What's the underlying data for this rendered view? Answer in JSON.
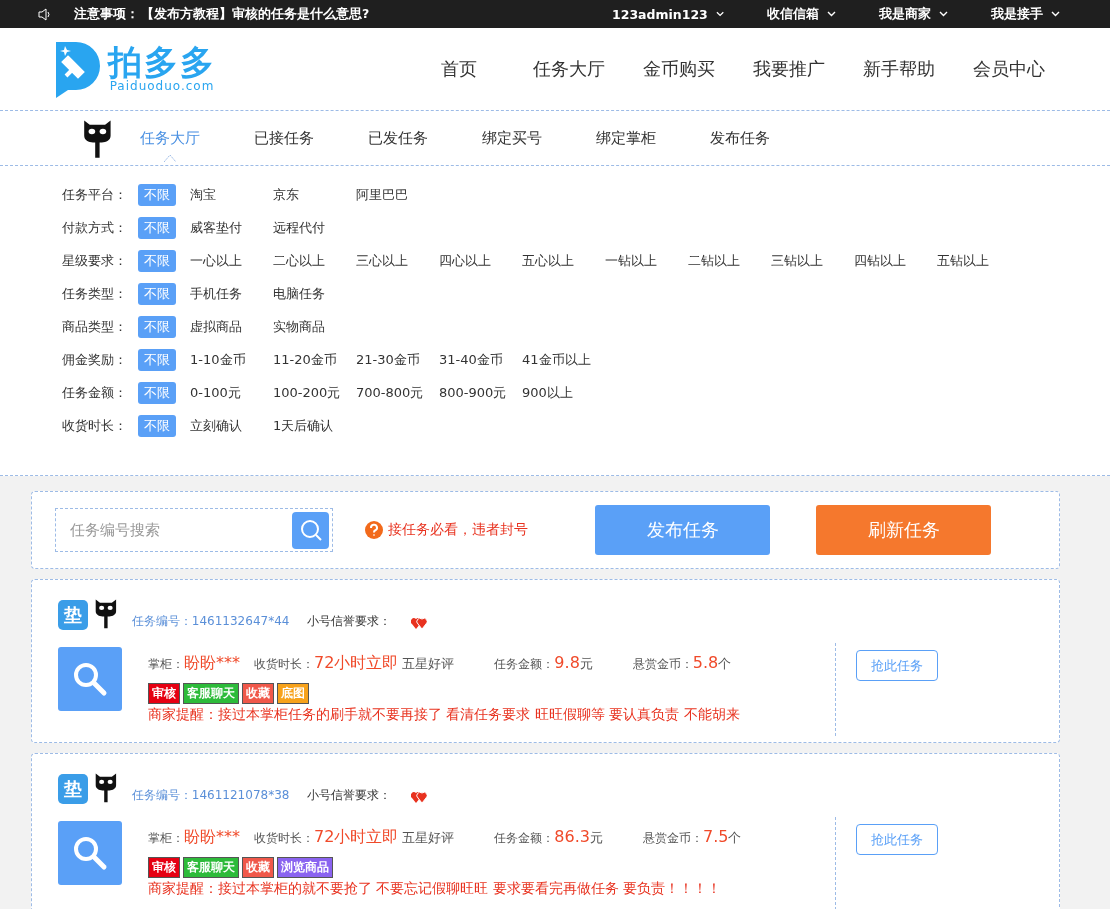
{
  "top_bar": {
    "notice_label": "注意事项：",
    "notice_text": "【发布方教程】审核的任务是什么意思?",
    "menus": [
      "123admin123",
      "收信信箱",
      "我是商家",
      "我是接手"
    ]
  },
  "header": {
    "logo_text": "拍多多",
    "logo_domain": "Paiduoduo.com",
    "nav": [
      {
        "label": "首页",
        "selected": false
      },
      {
        "label": "任务大厅",
        "selected": false
      },
      {
        "label": "金币购买",
        "selected": false
      },
      {
        "label": "我要推广",
        "selected": false
      },
      {
        "label": "新手帮助",
        "selected": false
      },
      {
        "label": "会员中心",
        "selected": false
      }
    ]
  },
  "sub_nav": [
    {
      "label": "任务大厅",
      "selected": true
    },
    {
      "label": "已接任务",
      "selected": false
    },
    {
      "label": "已发任务",
      "selected": false
    },
    {
      "label": "绑定买号",
      "selected": false
    },
    {
      "label": "绑定掌柜",
      "selected": false
    },
    {
      "label": "发布任务",
      "selected": false
    }
  ],
  "filters": [
    {
      "label": "任务平台：",
      "options": [
        {
          "label": "不限",
          "selected": true
        },
        {
          "label": "淘宝",
          "selected": false
        },
        {
          "label": "京东",
          "selected": false
        },
        {
          "label": "阿里巴巴",
          "selected": false
        }
      ]
    },
    {
      "label": "付款方式：",
      "options": [
        {
          "label": "不限",
          "selected": true
        },
        {
          "label": "威客垫付",
          "selected": false
        },
        {
          "label": "远程代付",
          "selected": false
        }
      ]
    },
    {
      "label": "星级要求：",
      "options": [
        {
          "label": "不限",
          "selected": true
        },
        {
          "label": "一心以上",
          "selected": false
        },
        {
          "label": "二心以上",
          "selected": false
        },
        {
          "label": "三心以上",
          "selected": false
        },
        {
          "label": "四心以上",
          "selected": false
        },
        {
          "label": "五心以上",
          "selected": false
        },
        {
          "label": "一钻以上",
          "selected": false
        },
        {
          "label": "二钻以上",
          "selected": false
        },
        {
          "label": "三钻以上",
          "selected": false
        },
        {
          "label": "四钻以上",
          "selected": false
        },
        {
          "label": "五钻以上",
          "selected": false
        }
      ]
    },
    {
      "label": "任务类型：",
      "options": [
        {
          "label": "不限",
          "selected": true
        },
        {
          "label": "手机任务",
          "selected": false
        },
        {
          "label": "电脑任务",
          "selected": false
        }
      ]
    },
    {
      "label": "商品类型：",
      "options": [
        {
          "label": "不限",
          "selected": true
        },
        {
          "label": "虚拟商品",
          "selected": false
        },
        {
          "label": "实物商品",
          "selected": false
        }
      ]
    },
    {
      "label": "佣金奖励：",
      "options": [
        {
          "label": "不限",
          "selected": true
        },
        {
          "label": "1-10金币",
          "selected": false
        },
        {
          "label": "11-20金币",
          "selected": false
        },
        {
          "label": "21-30金币",
          "selected": false
        },
        {
          "label": "31-40金币",
          "selected": false
        },
        {
          "label": "41金币以上",
          "selected": false
        }
      ]
    },
    {
      "label": "任务金额：",
      "options": [
        {
          "label": "不限",
          "selected": true
        },
        {
          "label": "0-100元",
          "selected": false
        },
        {
          "label": "100-200元",
          "selected": false
        },
        {
          "label": "700-800元",
          "selected": false
        },
        {
          "label": "800-900元",
          "selected": false
        },
        {
          "label": "900以上",
          "selected": false
        }
      ]
    },
    {
      "label": "收货时长：",
      "options": [
        {
          "label": "不限",
          "selected": true
        },
        {
          "label": "立刻确认",
          "selected": false
        },
        {
          "label": "1天后确认",
          "selected": false
        }
      ]
    }
  ],
  "toolbar": {
    "search": {
      "placeholder": "任务编号搜索"
    },
    "warning": "接任务必看，违者封号",
    "buttons": [
      {
        "label": "发布任务",
        "kind": "primary"
      },
      {
        "label": "刷新任务",
        "kind": "accent"
      }
    ]
  },
  "tasks": [
    {
      "badge": "垫",
      "id_label": "任务编号：",
      "id": "1461132647*44",
      "credit_label": "小号信誉要求：",
      "shop_label": "掌柜：",
      "shop": "盼盼***",
      "receive_label": "收货时长：",
      "receive": "72小时立即",
      "review": "五星好评",
      "amount_label": "任务金额：",
      "amount": "9.8",
      "amount_unit": "元",
      "reward_label": "悬赏金币：",
      "reward": "5.8",
      "reward_unit": "个",
      "tags": [
        {
          "label": "审核",
          "color": "#e60012"
        },
        {
          "label": "客服聊天",
          "color": "#2dbb3a"
        },
        {
          "label": "收藏",
          "color": "#f0584a"
        },
        {
          "label": "底图",
          "color": "#f7a21b"
        }
      ],
      "reminder": "商家提醒：接过本掌柜任务的刷手就不要再接了 看清任务要求 旺旺假聊等 要认真负责 不能胡来",
      "action": "抢此任务"
    },
    {
      "badge": "垫",
      "id_label": "任务编号：",
      "id": "1461121078*38",
      "credit_label": "小号信誉要求：",
      "shop_label": "掌柜：",
      "shop": "盼盼***",
      "receive_label": "收货时长：",
      "receive": "72小时立即",
      "review": "五星好评",
      "amount_label": "任务金额：",
      "amount": "86.3",
      "amount_unit": "元",
      "reward_label": "悬赏金币：",
      "reward": "7.5",
      "reward_unit": "个",
      "tags": [
        {
          "label": "审核",
          "color": "#e60012"
        },
        {
          "label": "客服聊天",
          "color": "#2dbb3a"
        },
        {
          "label": "收藏",
          "color": "#f0584a"
        },
        {
          "label": "浏览商品",
          "color": "#8a63f0"
        }
      ],
      "reminder": "商家提醒：接过本掌柜的就不要抢了 不要忘记假聊旺旺 要求要看完再做任务 要负责！！！！",
      "action": "抢此任务"
    }
  ]
}
